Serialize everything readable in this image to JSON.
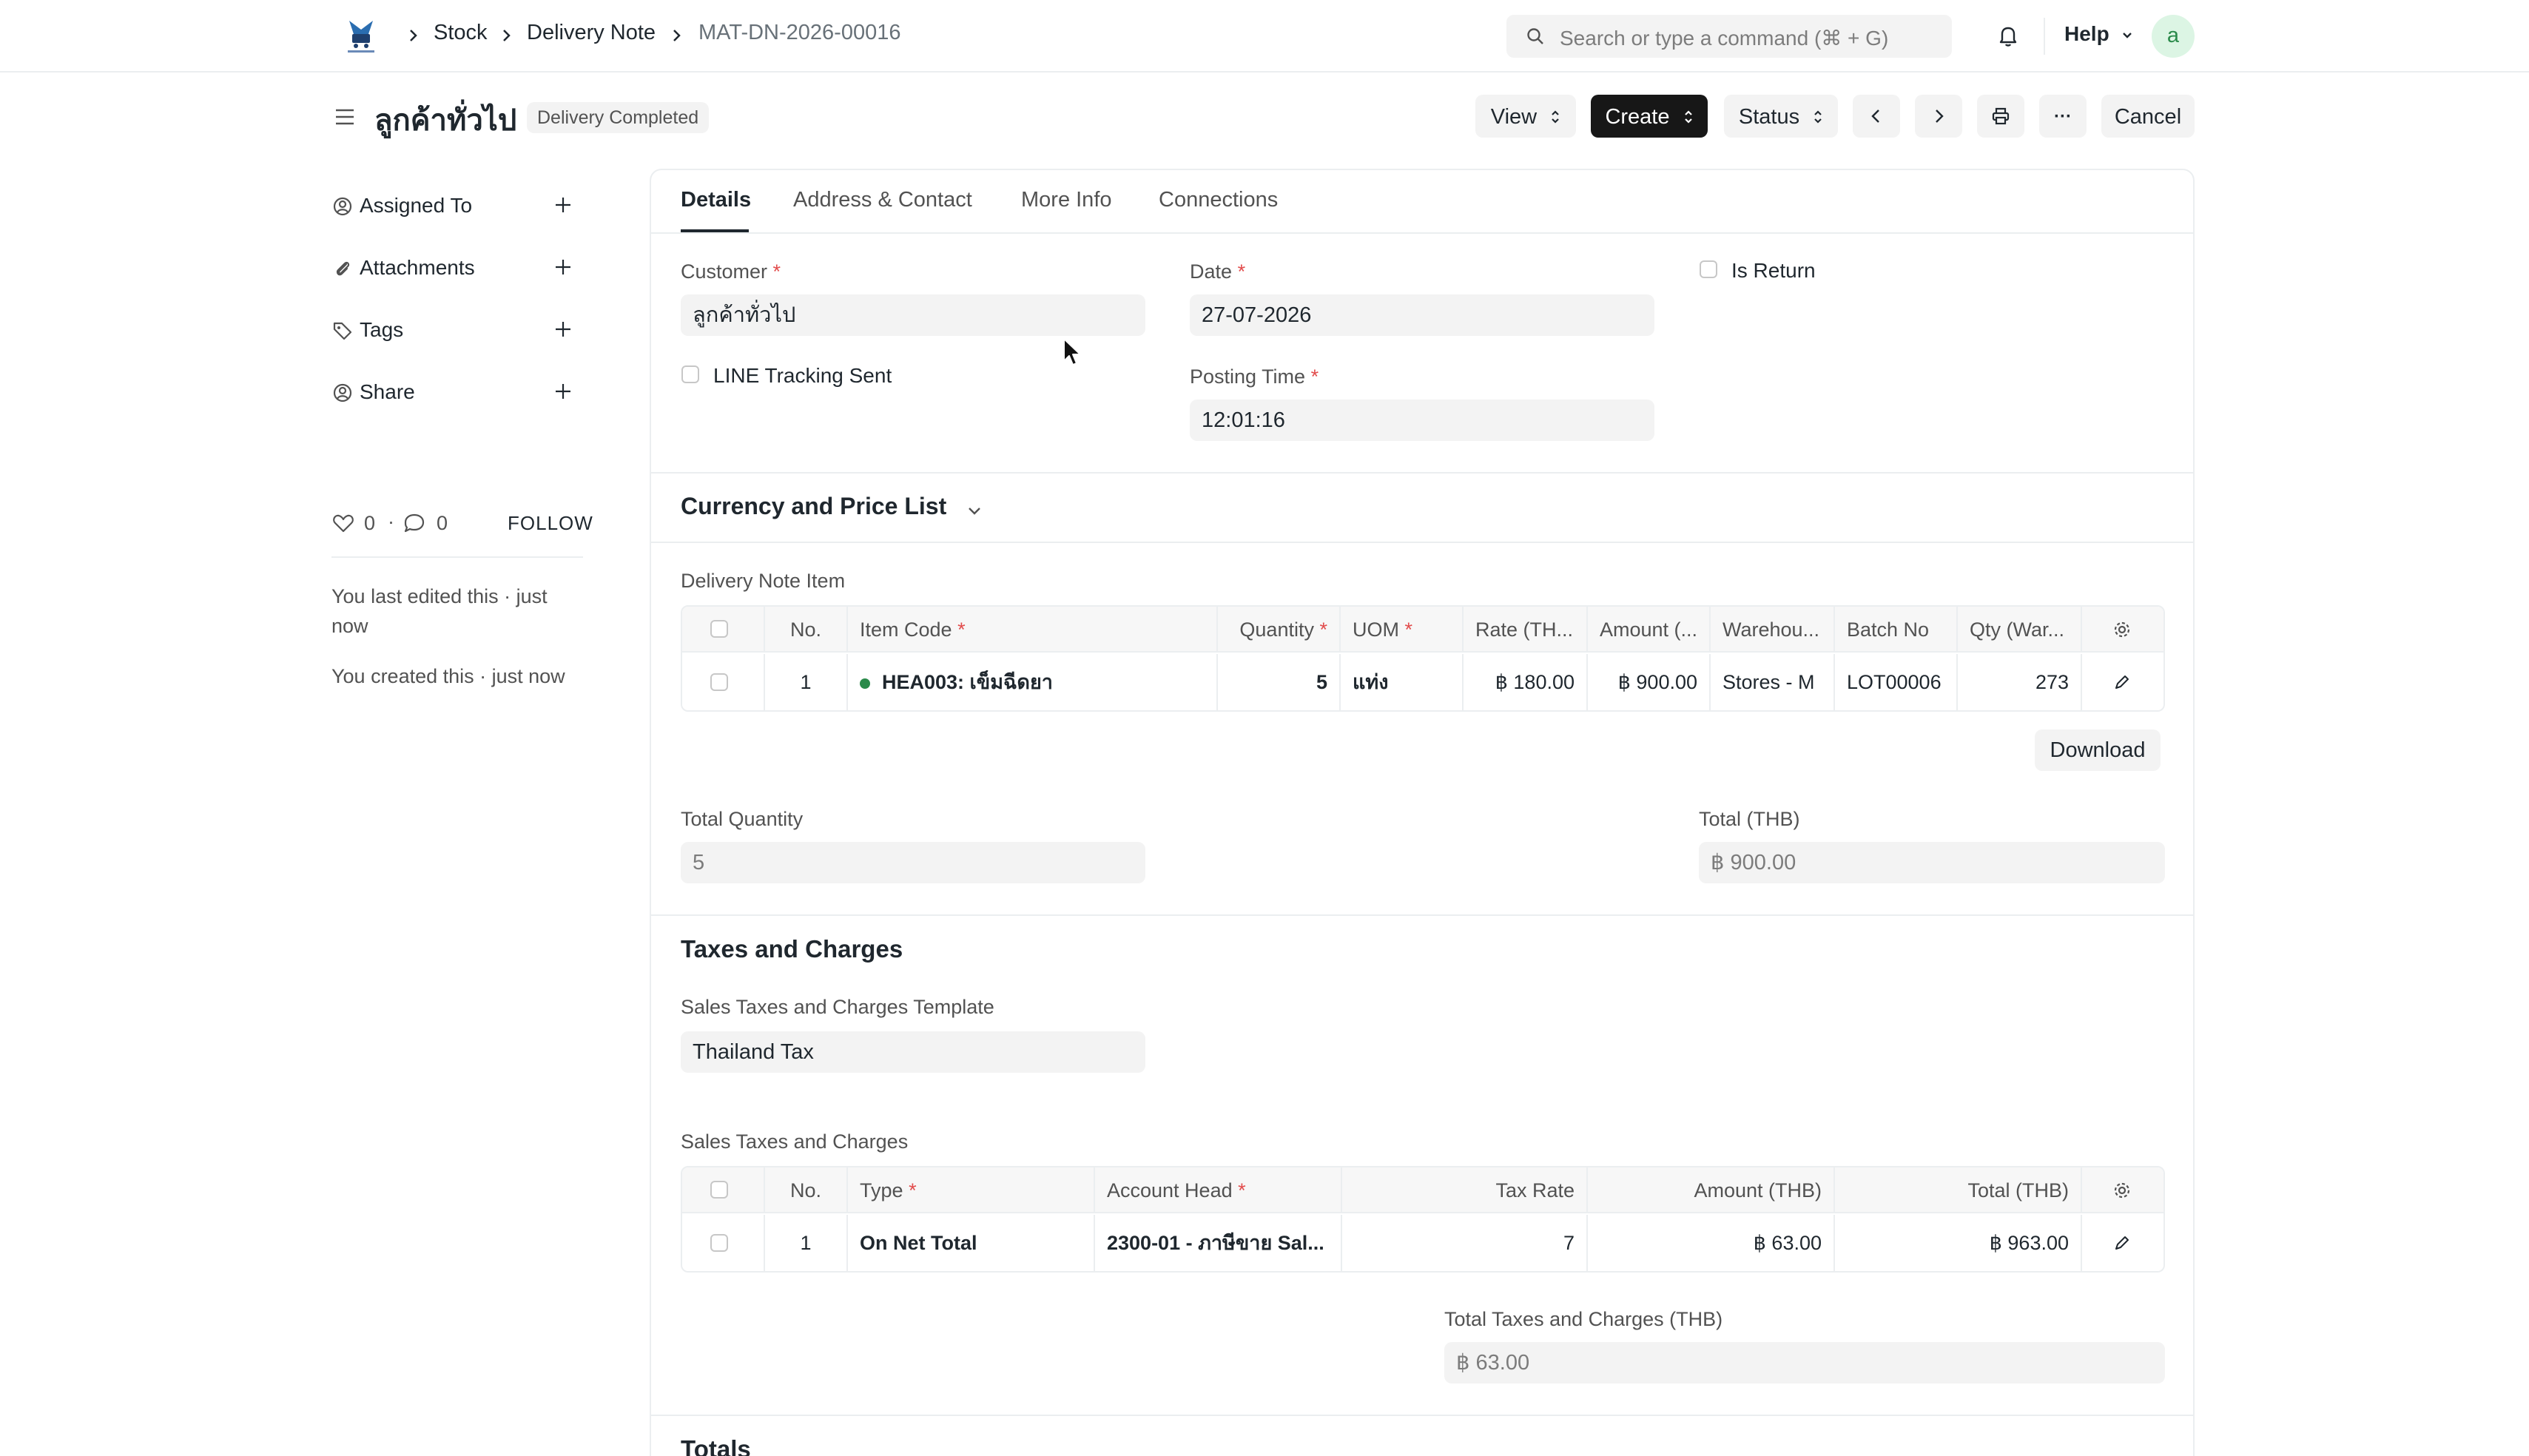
{
  "navbar": {
    "breadcrumbs": [
      "Stock",
      "Delivery Note",
      "MAT-DN-2026-00016"
    ],
    "search_placeholder": "Search or type a command (⌘ + G)",
    "help_label": "Help",
    "avatar_initial": "a"
  },
  "page": {
    "title": "ลูกค้าทั่วไป",
    "status_badge": "Delivery Completed",
    "buttons": {
      "view": "View",
      "create": "Create",
      "status": "Status",
      "more": "···",
      "cancel": "Cancel"
    }
  },
  "sidebar": {
    "items": [
      {
        "label": "Assigned To",
        "icon": "assign-icon"
      },
      {
        "label": "Attachments",
        "icon": "paperclip-icon"
      },
      {
        "label": "Tags",
        "icon": "tag-icon"
      },
      {
        "label": "Share",
        "icon": "share-icon"
      }
    ],
    "likes": "0",
    "comments": "0",
    "follow": "FOLLOW",
    "last_edited": "You last edited this · just now",
    "created": "You created this · just now"
  },
  "tabs": [
    "Details",
    "Address & Contact",
    "More Info",
    "Connections"
  ],
  "details": {
    "customer_label": "Customer",
    "customer_value": "ลูกค้าทั่วไป",
    "date_label": "Date",
    "date_value": "27-07-2026",
    "is_return_label": "Is Return",
    "line_tracking_label": "LINE Tracking Sent",
    "posting_time_label": "Posting Time",
    "posting_time_value": "12:01:16"
  },
  "currency_section": {
    "title": "Currency and Price List"
  },
  "items_table": {
    "label": "Delivery Note Item",
    "headers": [
      "No.",
      "Item Code",
      "Quantity",
      "UOM",
      "Rate (TH...",
      "Amount (...",
      "Warehou...",
      "Batch No",
      "Qty (War..."
    ],
    "rows": [
      {
        "no": "1",
        "item_code": "HEA003: เข็มฉีดยา",
        "quantity": "5",
        "uom": "แท่ง",
        "rate": "฿ 180.00",
        "amount": "฿ 900.00",
        "warehouse": "Stores - M",
        "batch": "LOT00006",
        "qty_warehouse": "273"
      }
    ],
    "download_label": "Download"
  },
  "totals_qty": {
    "total_quantity_label": "Total Quantity",
    "total_quantity_value": "5",
    "total_label": "Total (THB)",
    "total_value": "฿ 900.00"
  },
  "taxes": {
    "title": "Taxes and Charges",
    "template_label": "Sales Taxes and Charges Template",
    "template_value": "Thailand Tax",
    "table_label": "Sales Taxes and Charges",
    "headers": [
      "No.",
      "Type",
      "Account Head",
      "Tax Rate",
      "Amount (THB)",
      "Total (THB)"
    ],
    "rows": [
      {
        "no": "1",
        "type": "On Net Total",
        "account_head": "2300-01 - ภาษีขาย Sal...",
        "tax_rate": "7",
        "amount": "฿ 63.00",
        "total": "฿ 963.00"
      }
    ],
    "total_taxes_label": "Total Taxes and Charges (THB)",
    "total_taxes_value": "฿ 63.00"
  },
  "totals_section": {
    "title": "Totals"
  },
  "colors": {
    "accent": "#171717",
    "required": "#e24c4c",
    "status_dot": "#2a8a4a"
  }
}
